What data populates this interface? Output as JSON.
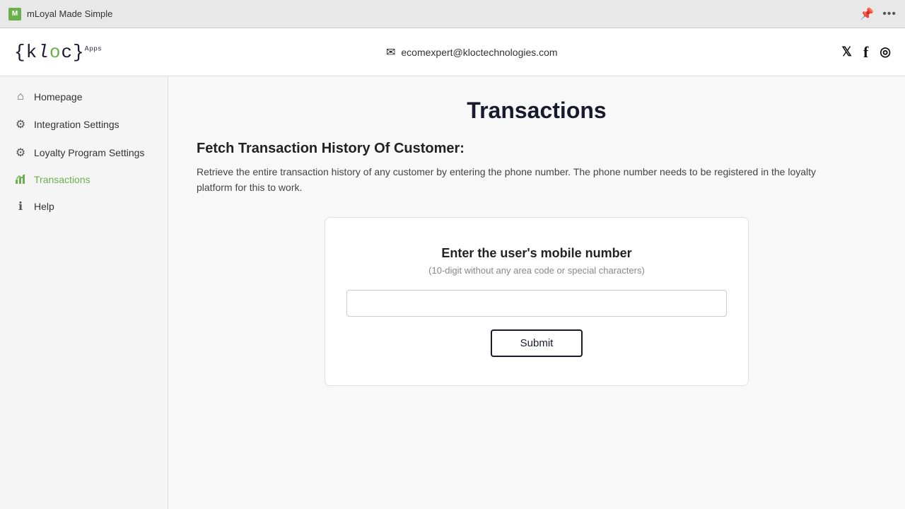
{
  "browser": {
    "title": "mLoyal Made Simple",
    "pin_icon": "📌",
    "menu_icon": "•••"
  },
  "header": {
    "logo_display": "{kloc}",
    "logo_parts": {
      "open_brace": "{",
      "k": "k",
      "l": "l",
      "o": "o",
      "c": "c",
      "close_brace": "}",
      "apps": "Apps"
    },
    "email": "ecomexpert@kloctechnologies.com",
    "email_icon": "✉"
  },
  "sidebar": {
    "items": [
      {
        "id": "homepage",
        "label": "Homepage",
        "icon": "home",
        "active": false
      },
      {
        "id": "integration-settings",
        "label": "Integration Settings",
        "icon": "gear",
        "active": false
      },
      {
        "id": "loyalty-program-settings",
        "label": "Loyalty Program Settings",
        "icon": "gear",
        "active": false
      },
      {
        "id": "transactions",
        "label": "Transactions",
        "icon": "chart",
        "active": true
      },
      {
        "id": "help",
        "label": "Help",
        "icon": "info",
        "active": false
      }
    ]
  },
  "main": {
    "page_title": "Transactions",
    "section_title": "Fetch Transaction History Of Customer:",
    "section_desc": "Retrieve the entire transaction history of any customer by entering the phone number. The phone number needs to be registered in the loyalty platform for this to work.",
    "card": {
      "title": "Enter the user's mobile number",
      "subtitle": "(10-digit without any area code or special characters)",
      "input_placeholder": "",
      "submit_label": "Submit"
    }
  },
  "colors": {
    "accent": "#6ab04c",
    "dark": "#1a1a2e",
    "active_nav": "#6ab04c"
  }
}
